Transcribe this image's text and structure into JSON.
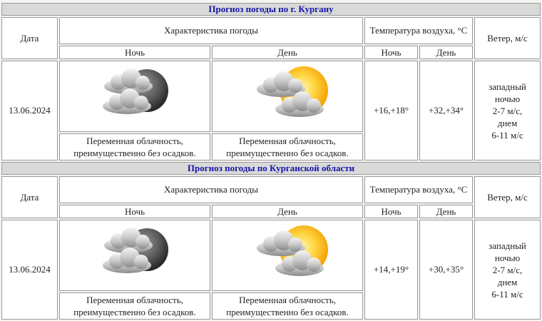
{
  "blocks": [
    {
      "title": "Прогноз погоды по г. Кургану",
      "header": {
        "date": "Дата",
        "characteristic": "Характеристика погоды",
        "temperature": "Температура воздуха, °С",
        "wind": "Ветер, м/с",
        "night": "Ночь",
        "day": "День",
        "temp_night": "Ночь",
        "temp_day": "День"
      },
      "row": {
        "date": "13.06.2024",
        "night_desc": "Переменная облачность, преимущественно без осадков.",
        "day_desc": "Переменная облачность, преимущественно без осадков.",
        "temp_night": "+16,+18°",
        "temp_day": "+32,+34°",
        "wind": [
          "западный",
          "ночью",
          "2-7 м/с,",
          "днем",
          "6-11 м/с"
        ],
        "night_icon": "cloudy-moon-icon",
        "day_icon": "cloudy-sun-icon"
      }
    },
    {
      "title": "Прогноз погоды по Курганской области",
      "header": {
        "date": "Дата",
        "characteristic": "Характеристика погоды",
        "temperature": "Температура воздуха, °С",
        "wind": "Ветер, м/с",
        "night": "Ночь",
        "day": "День",
        "temp_night": "Ночь",
        "temp_day": "День"
      },
      "row": {
        "date": "13.06.2024",
        "night_desc": "Переменная облачность, преимущественно без осадков.",
        "day_desc": "Переменная облачность, преимущественно без осадков.",
        "temp_night": "+14,+19°",
        "temp_day": "+30,+35°",
        "wind": [
          "западный",
          "ночью",
          "2-7 м/с,",
          "днем",
          "6-11 м/с"
        ],
        "night_icon": "cloudy-moon-icon",
        "day_icon": "cloudy-sun-icon"
      }
    }
  ]
}
